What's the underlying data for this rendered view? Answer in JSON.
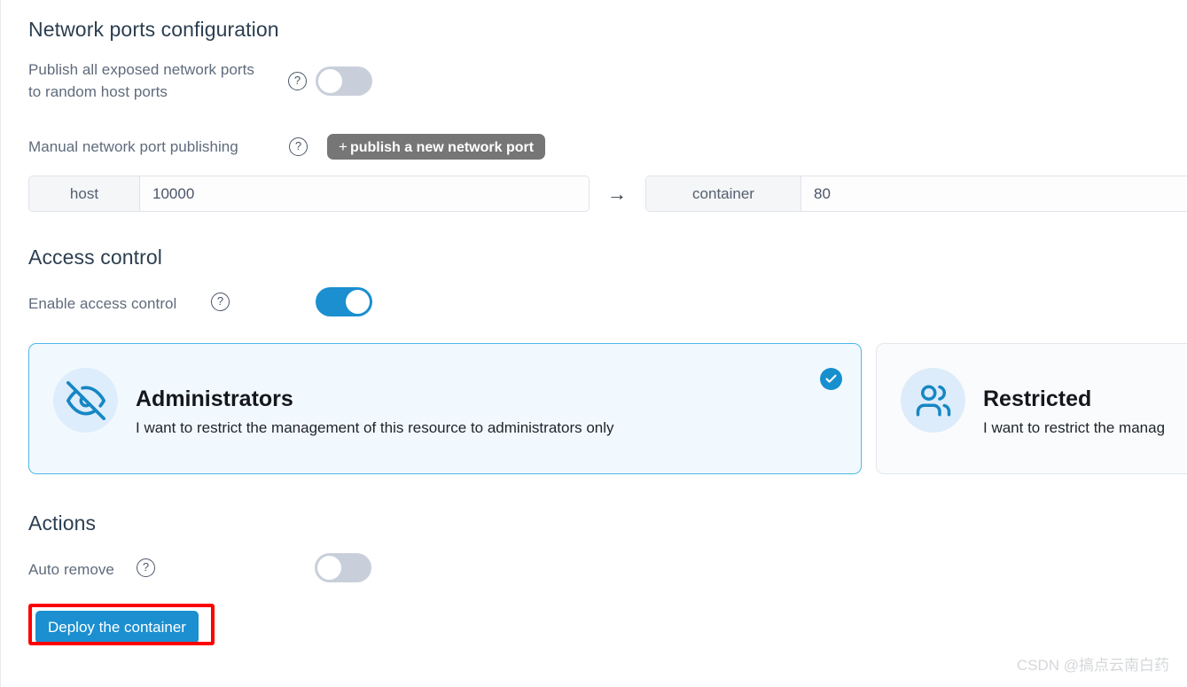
{
  "network_section": {
    "title": "Network ports configuration",
    "publish_all": {
      "label": "Publish all exposed network ports to random host ports",
      "help_icon": "question-circle-icon",
      "toggle_state": "off"
    },
    "manual_publishing": {
      "label": "Manual network port publishing",
      "help_icon": "question-circle-icon",
      "add_button_plus": "+",
      "add_button_label": "publish a new network port"
    },
    "port_mapping": {
      "host_addon": "host",
      "host_value": "10000",
      "arrow": "→",
      "container_addon": "container",
      "container_value": "80"
    }
  },
  "access_section": {
    "title": "Access control",
    "enable": {
      "label": "Enable access control",
      "help_icon": "question-circle-icon",
      "toggle_state": "on"
    },
    "cards": [
      {
        "title": "Administrators",
        "description": "I want to restrict the management of this resource to administrators only",
        "icon": "eye-off-icon",
        "selected": true,
        "check_icon": "check-circle-icon"
      },
      {
        "title": "Restricted",
        "description": "I want to restrict the manag",
        "icon": "users-icon",
        "selected": false
      }
    ]
  },
  "actions_section": {
    "title": "Actions",
    "auto_remove": {
      "label": "Auto remove",
      "help_icon": "question-circle-icon",
      "toggle_state": "off"
    },
    "deploy_button_label": "Deploy the container"
  },
  "watermark": "CSDN @搞点云南白药",
  "colors": {
    "accent_blue": "#1b8fd0",
    "toggle_off_gray": "#c9cfda",
    "gray_button": "#767676",
    "annotation_red": "#fe0000",
    "selected_card_bg": "#f2f9fe",
    "selected_card_border": "#4cb8e8"
  }
}
